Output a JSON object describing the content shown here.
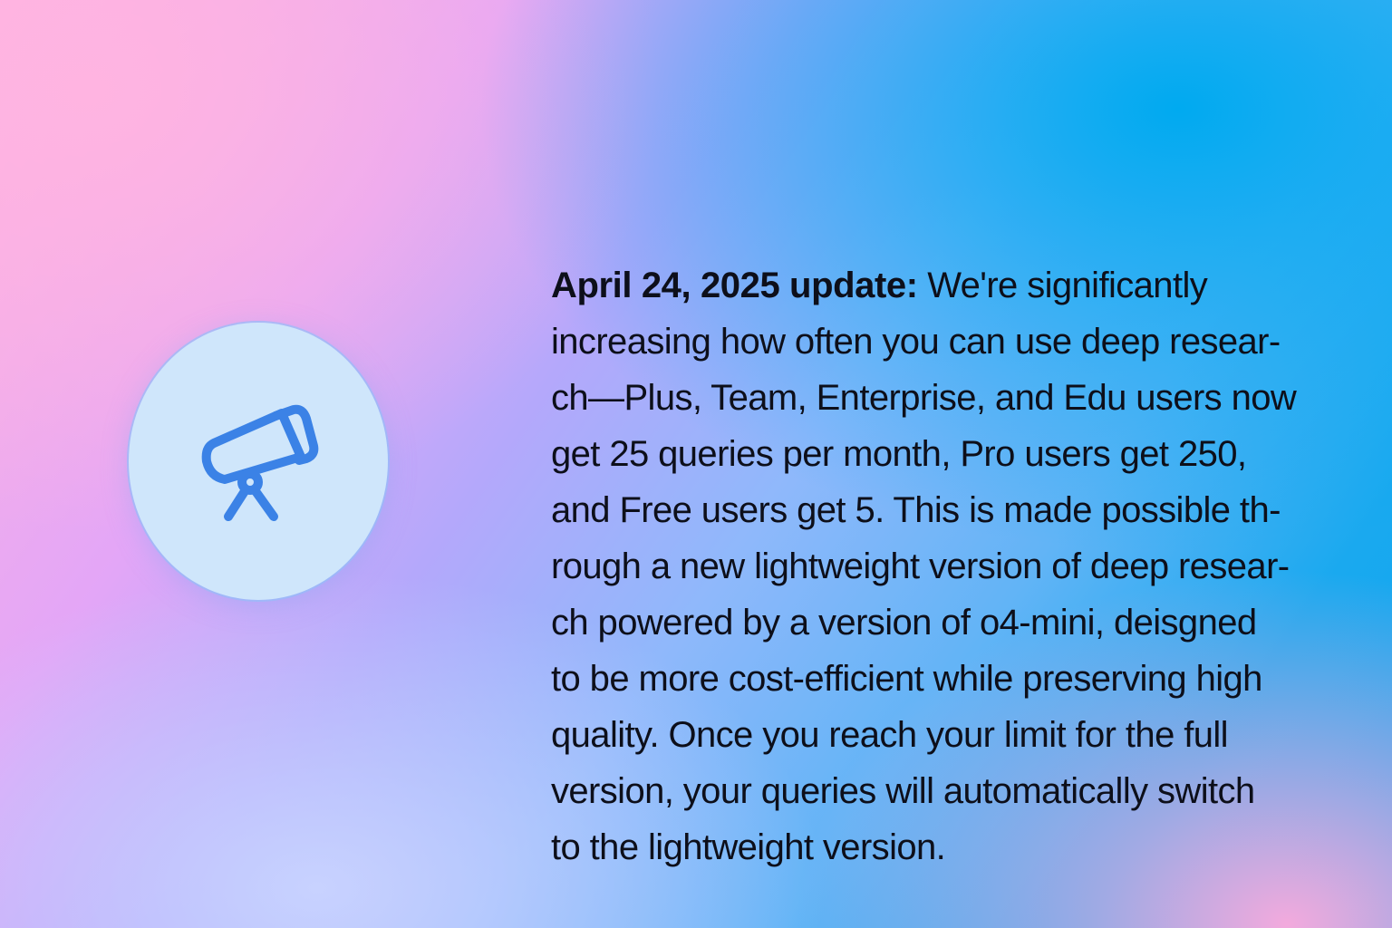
{
  "announcement": {
    "icon": "telescope-icon",
    "headline": "April 24, 2025 update:",
    "lines": [
      " We're significantly",
      "increasing how often you can use deep resear-",
      "ch—Plus, Team, Enterprise, and Edu users now",
      "get 25 queries per month, Pro users get 250,",
      "and Free users get 5. This is made possible th-",
      "rough a new lightweight version of deep resear-",
      "ch powered by a version of o4-mini, deisgned",
      "to be more cost-efficient while preserving high",
      "quality. Once you reach your limit for the full",
      "version, your queries will automatically switch",
      "to the lightweight version."
    ]
  },
  "colors": {
    "icon_stroke": "#3b82e6",
    "icon_background": "#cfe6fb",
    "text": "#0d0f1a"
  }
}
